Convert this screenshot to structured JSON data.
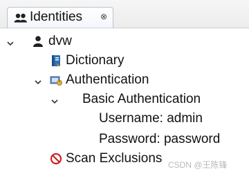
{
  "tab": {
    "title": "Identities",
    "close_glyph": "⊗",
    "icon": "identities-icon"
  },
  "tree": {
    "root": {
      "label": "dvw",
      "icon": "user-icon",
      "expanded": true
    },
    "dictionary": {
      "label": "Dictionary",
      "icon": "dictionary-icon"
    },
    "authentication": {
      "label": "Authentication",
      "icon": "authentication-icon",
      "expanded": true
    },
    "basic_auth": {
      "label": "Basic Authentication",
      "expanded": true
    },
    "username": {
      "label": "Username: admin"
    },
    "password": {
      "label": "Password: password"
    },
    "scan_exclusions": {
      "label": "Scan Exclusions",
      "icon": "no-entry-icon"
    }
  },
  "watermark": "CSDN @王陈锋",
  "colors": {
    "accent": "#3c6eb4",
    "no_entry": "#cc2222"
  }
}
